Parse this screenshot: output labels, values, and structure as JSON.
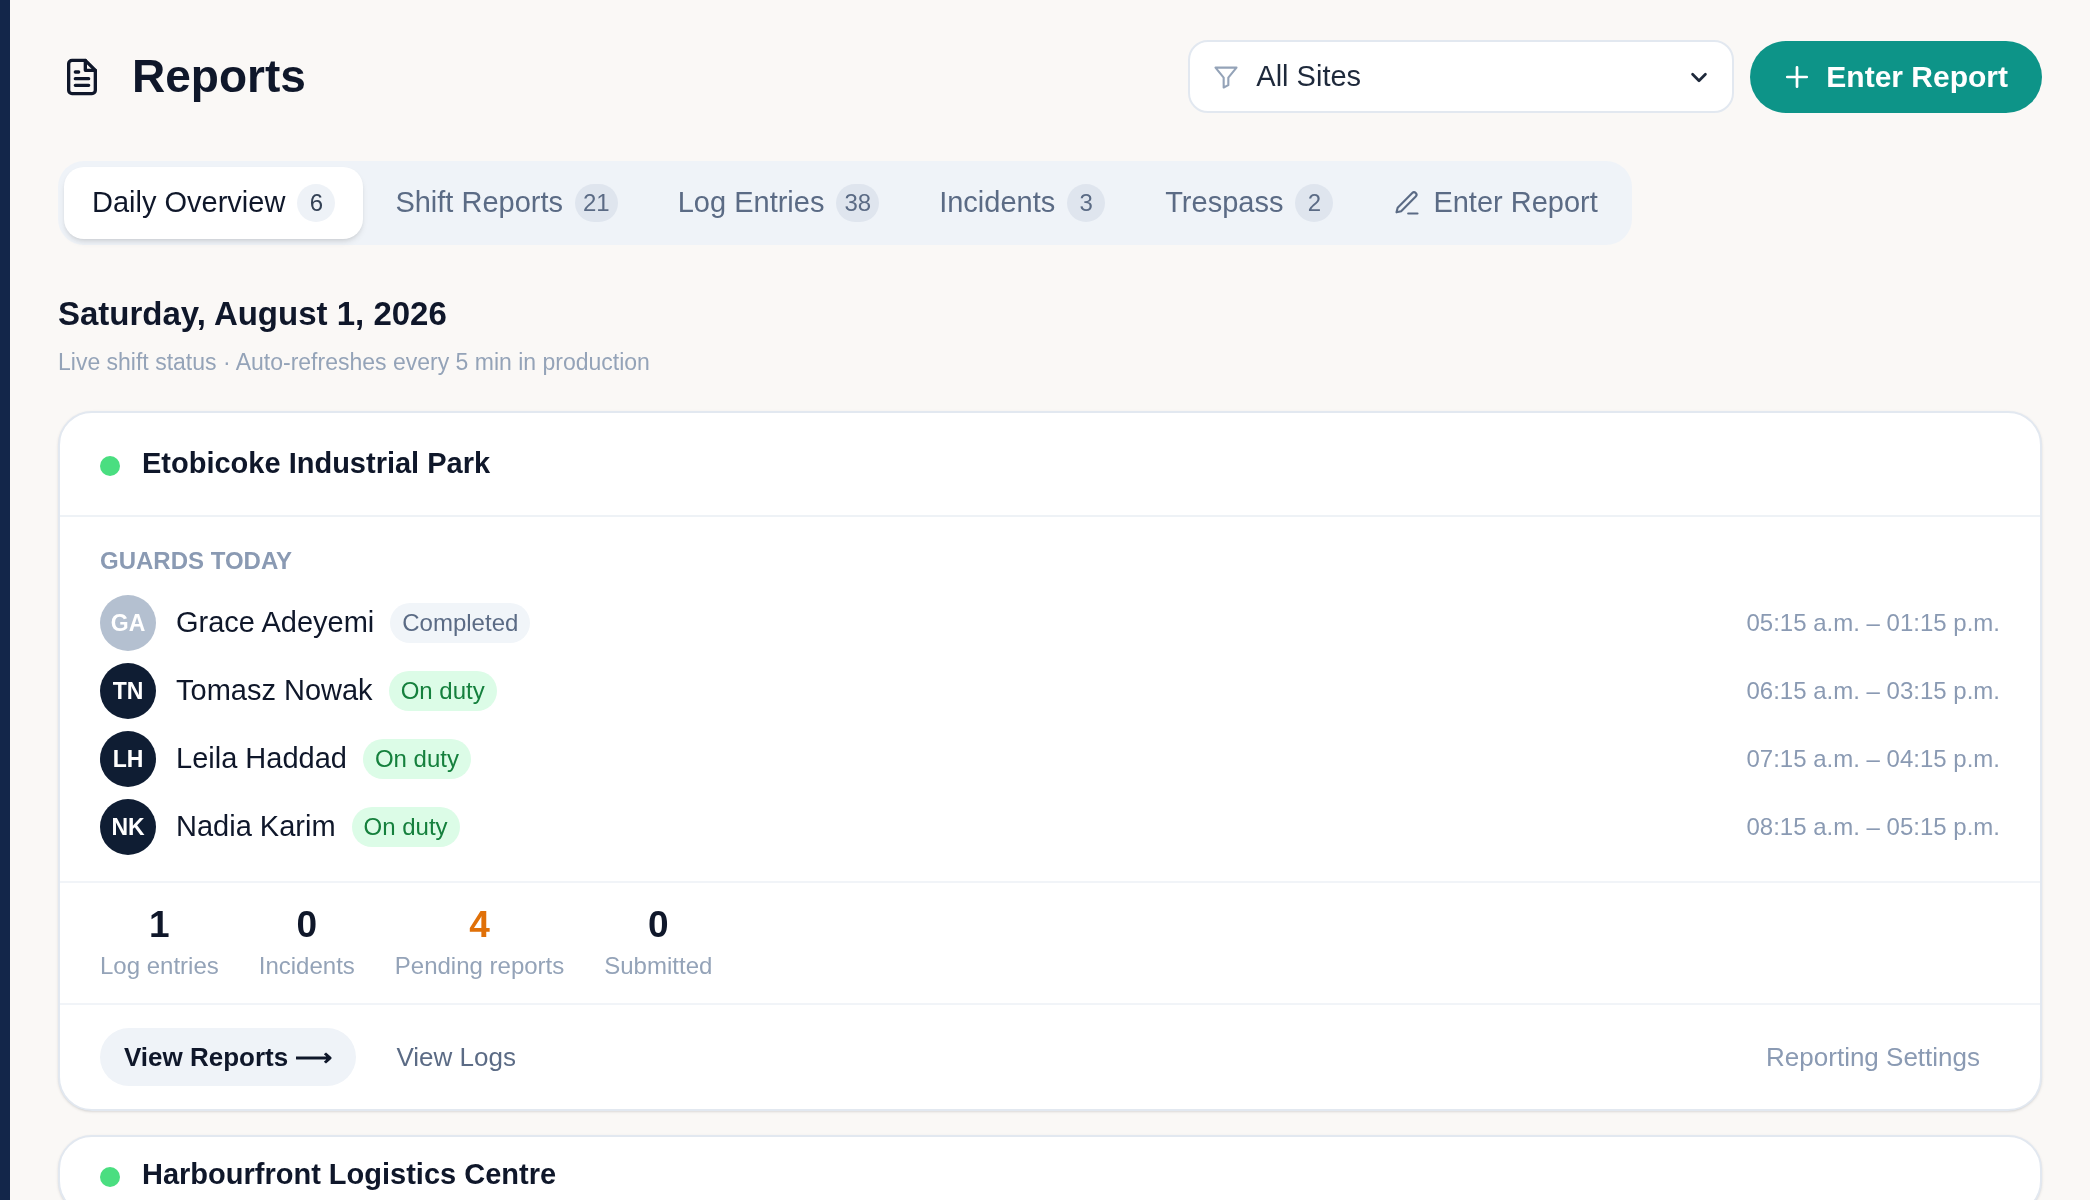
{
  "page": {
    "title": "Reports"
  },
  "site_filter": {
    "value": "All Sites"
  },
  "primary_button": {
    "label": "Enter Report"
  },
  "tabs": [
    {
      "label": "Daily Overview",
      "count": "6",
      "selected": true,
      "kind": "tab"
    },
    {
      "label": "Shift Reports",
      "count": "21",
      "selected": false,
      "kind": "tab"
    },
    {
      "label": "Log Entries",
      "count": "38",
      "selected": false,
      "kind": "tab"
    },
    {
      "label": "Incidents",
      "count": "3",
      "selected": false,
      "kind": "tab"
    },
    {
      "label": "Trespass",
      "count": "2",
      "selected": false,
      "kind": "tab"
    },
    {
      "label": "Enter Report",
      "selected": false,
      "kind": "action"
    }
  ],
  "date_heading": "Saturday, August 1, 2026",
  "subtitle": "Live shift status · Auto-refreshes every 5 min in production",
  "sites": [
    {
      "name": "Etobicoke Industrial Park",
      "color": "#4ade80",
      "guards_heading": "GUARDS TODAY",
      "guards": [
        {
          "initials": "GA",
          "name": "Grace Adeyemi",
          "status": "Completed",
          "kind": "completed",
          "shift": "05:15 a.m. – 01:15 p.m."
        },
        {
          "initials": "TN",
          "name": "Tomasz Nowak",
          "status": "On duty",
          "kind": "on_duty",
          "shift": "06:15 a.m. – 03:15 p.m."
        },
        {
          "initials": "LH",
          "name": "Leila Haddad",
          "status": "On duty",
          "kind": "on_duty",
          "shift": "07:15 a.m. – 04:15 p.m."
        },
        {
          "initials": "NK",
          "name": "Nadia Karim",
          "status": "On duty",
          "kind": "on_duty",
          "shift": "08:15 a.m. – 05:15 p.m."
        }
      ],
      "stats": [
        {
          "value": "1",
          "label": "Log entries",
          "kind": "normal"
        },
        {
          "value": "0",
          "label": "Incidents",
          "kind": "normal"
        },
        {
          "value": "4",
          "label": "Pending reports",
          "kind": "warning"
        },
        {
          "value": "0",
          "label": "Submitted",
          "kind": "normal"
        }
      ],
      "actions": {
        "view_reports": "View Reports ⟶",
        "view_logs": "View Logs",
        "settings": "Reporting Settings"
      }
    },
    {
      "name": "Harbourfront Logistics Centre",
      "color": "#4ade80"
    }
  ]
}
